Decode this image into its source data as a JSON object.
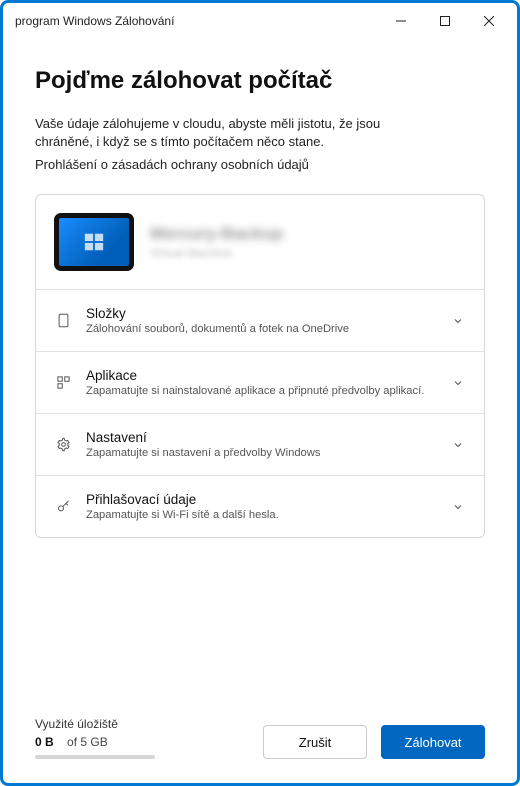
{
  "window": {
    "title": "program Windows Zálohování"
  },
  "headline": "Pojďme zálohovat počítač",
  "intro": "Vaše údaje zálohujeme v cloudu, abyste měli jistotu, že jsou chráněné, i když se s tímto počítačem něco stane.",
  "privacy": "Prohlášení o zásadách ochrany osobních údajů",
  "device": {
    "name": "Mercury-Backup",
    "sub": "Virtual Machine"
  },
  "sections": [
    {
      "id": "folders",
      "icon": "folder-icon",
      "title": "Složky",
      "sub": "Zálohování souborů, dokumentů a fotek na OneDrive"
    },
    {
      "id": "apps",
      "icon": "apps-icon",
      "title": "Aplikace",
      "sub": "Zapamatujte si nainstalované aplikace a připnuté předvolby aplikací."
    },
    {
      "id": "settings",
      "icon": "gear-icon",
      "title": "Nastavení",
      "sub": "Zapamatujte si nastavení a předvolby Windows"
    },
    {
      "id": "credentials",
      "icon": "key-icon",
      "title": "Přihlašovací údaje",
      "sub": "Zapamatujte si Wi-Fi sítě a další hesla."
    }
  ],
  "storage": {
    "label": "Využité úložiště",
    "used": "0 B",
    "of": "of",
    "total": "5 GB",
    "percent": 0
  },
  "buttons": {
    "cancel": "Zrušit",
    "backup": "Zálohovat"
  }
}
